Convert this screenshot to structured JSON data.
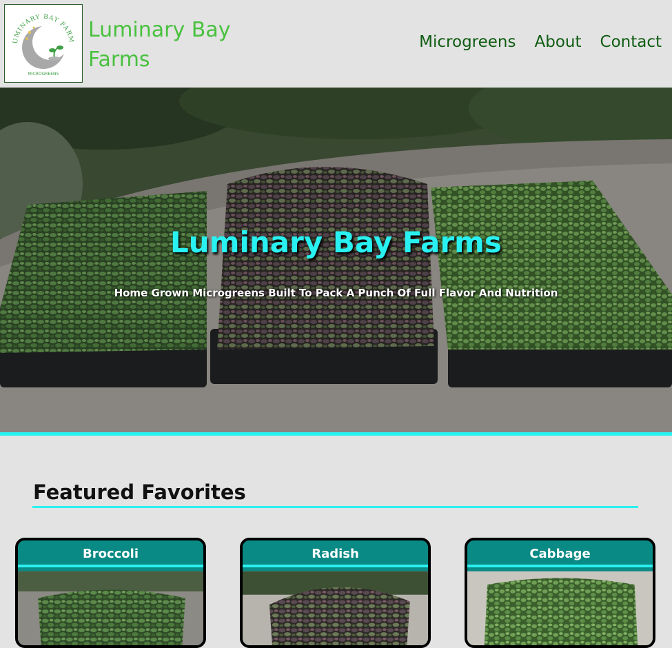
{
  "header": {
    "logo_alt": "Luminary Bay Farms logo",
    "logo_ring_text": "LUMINARY BAY FARMS",
    "logo_bottom_text": "MICROGREENS",
    "brand_line1": "Luminary Bay",
    "brand_line2": "Farms",
    "nav": [
      {
        "label": "Microgreens"
      },
      {
        "label": "About"
      },
      {
        "label": "Contact"
      }
    ]
  },
  "hero": {
    "title": "Luminary Bay Farms",
    "subtitle": "Home Grown Microgreens Built To Pack A Punch Of Full Flavor And Nutrition"
  },
  "featured": {
    "title": "Featured Favorites",
    "cards": [
      {
        "name": "Broccoli"
      },
      {
        "name": "Radish"
      },
      {
        "name": "Cabbage"
      }
    ]
  },
  "colors": {
    "accent_cyan": "#2af1f1",
    "brand_green": "#49c13f",
    "nav_green": "#0f5c12",
    "card_teal": "#0a8a84"
  }
}
